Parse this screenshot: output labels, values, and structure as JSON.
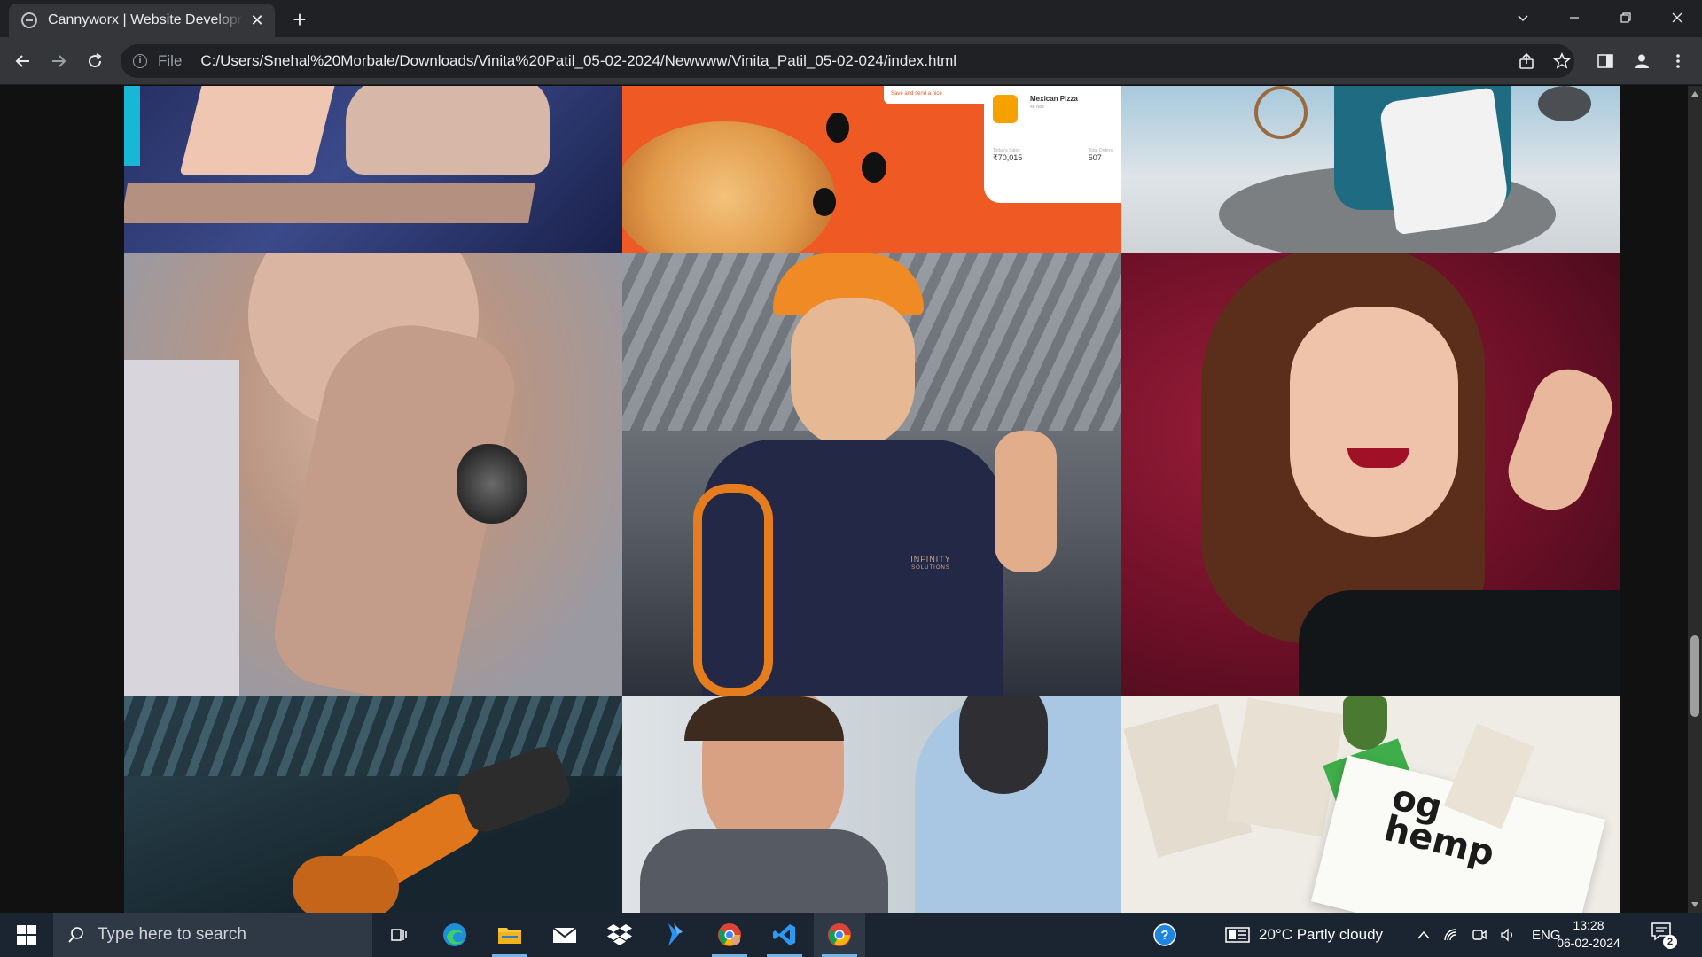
{
  "browser": {
    "tab_title": "Cannyworx | Website Development",
    "tab_close": "✕",
    "new_tab": "+",
    "window_controls": [
      "⌄",
      "—",
      "❐",
      "✕"
    ],
    "address": {
      "scheme_label": "File",
      "url": "C:/Users/Snehal%20Morbale/Downloads/Vinita%20Patil_05-02-2024/Newwww/Vinita_Patil_05-02-024/index.html"
    }
  },
  "page": {
    "gallery": [
      {
        "name": "workspace-laptop",
        "colors": [
          "#273063",
          "#3b4a8a"
        ]
      },
      {
        "name": "pizza-app-promo",
        "card_title": "Mexican Pizza",
        "card_sub": "48 Nos",
        "stats": [
          {
            "label": "Today's Sales",
            "value": "₹70,015"
          },
          {
            "label": "Total Orders",
            "value": "507"
          }
        ],
        "banner": "Save and send a nice"
      },
      {
        "name": "armchair-interior"
      },
      {
        "name": "ring-jewellery"
      },
      {
        "name": "infinity-solutions-worker",
        "logo_text": "INFINITY",
        "logo_sub": "SOLUTIONS"
      },
      {
        "name": "woman-portrait"
      },
      {
        "name": "robot-arm"
      },
      {
        "name": "business-handshake"
      },
      {
        "name": "og-hemp-branding",
        "brand_line1": "og",
        "brand_line2": "hemp"
      }
    ]
  },
  "taskbar": {
    "search_placeholder": "Type here to search",
    "weather": "20°C  Partly cloudy",
    "language": "ENG",
    "time": "13:28",
    "date": "06-02-2024",
    "notifications_count": "2"
  },
  "colors": {
    "chrome_dark": "#202124",
    "chrome_toolbar": "#35363a",
    "taskbar": "#1b2431",
    "pizza_orange": "#ef5a24"
  }
}
